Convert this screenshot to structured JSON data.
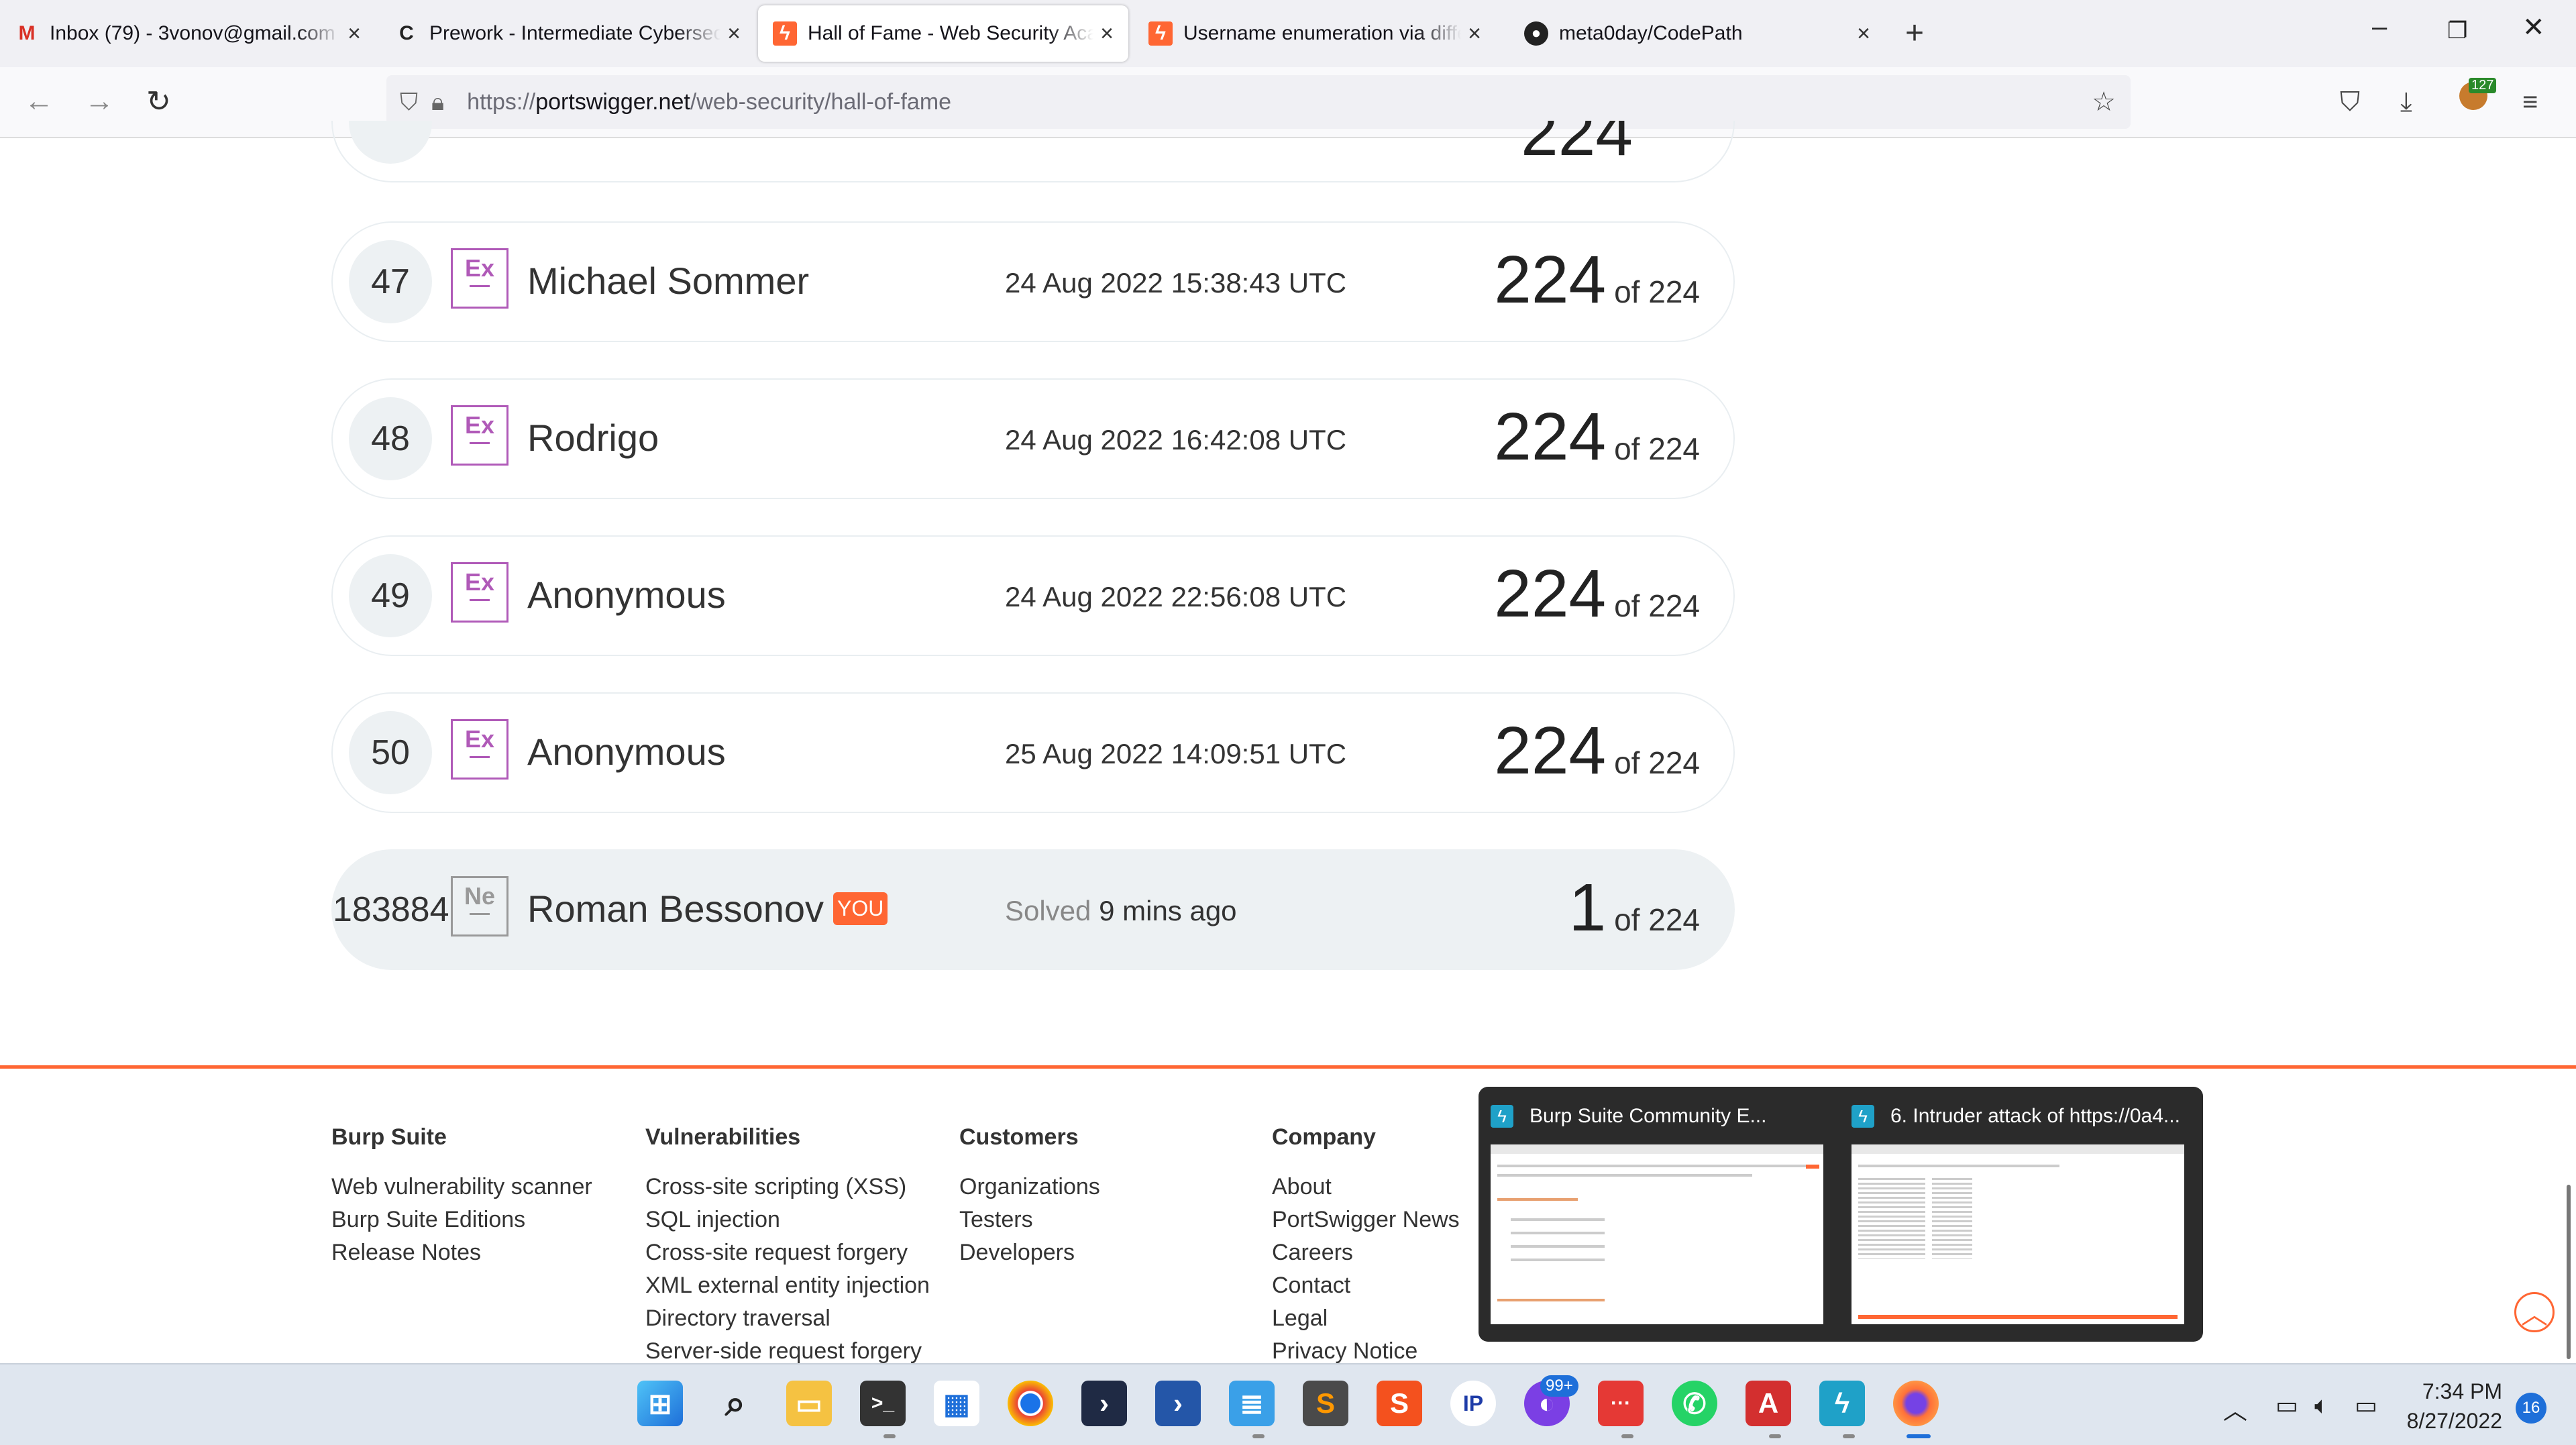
{
  "browser": {
    "tabs": [
      {
        "title": "Inbox (79) - 3vonov@gmail.com",
        "favicon": "gmail-icon",
        "active": false
      },
      {
        "title": "Prework - Intermediate Cybersecurity",
        "favicon": "codepath-icon",
        "active": false
      },
      {
        "title": "Hall of Fame - Web Security Academy",
        "favicon": "portswigger-icon",
        "active": true
      },
      {
        "title": "Username enumeration via different responses",
        "favicon": "portswigger-icon",
        "active": false
      },
      {
        "title": "meta0day/CodePath",
        "favicon": "github-icon",
        "active": false
      }
    ],
    "url": {
      "scheme": "https://",
      "host": "portswigger.net",
      "path": "/web-security/hall-of-fame"
    },
    "extension_badge": "127"
  },
  "leaderboard": {
    "rows": [
      {
        "rank": "47",
        "badge": "Ex",
        "name": "Michael Sommer",
        "date": "24 Aug 2022 15:38:43 UTC",
        "score": "224",
        "total": "of 224"
      },
      {
        "rank": "48",
        "badge": "Ex",
        "name": "Rodrigo",
        "date": "24 Aug 2022 16:42:08 UTC",
        "score": "224",
        "total": "of 224"
      },
      {
        "rank": "49",
        "badge": "Ex",
        "name": "Anonymous",
        "date": "24 Aug 2022 22:56:08 UTC",
        "score": "224",
        "total": "of 224"
      },
      {
        "rank": "50",
        "badge": "Ex",
        "name": "Anonymous",
        "date": "25 Aug 2022 14:09:51 UTC",
        "score": "224",
        "total": "of 224"
      }
    ],
    "current_user": {
      "rank": "183884",
      "badge": "Ne",
      "name": "Roman Bessonov",
      "you_label": "YOU",
      "solved_label": "Solved",
      "solved_time": "9 mins ago",
      "score": "1",
      "total": "of 224"
    }
  },
  "footer": {
    "columns": [
      {
        "heading": "Burp Suite",
        "links": [
          "Web vulnerability scanner",
          "Burp Suite Editions",
          "Release Notes"
        ]
      },
      {
        "heading": "Vulnerabilities",
        "links": [
          "Cross-site scripting (XSS)",
          "SQL injection",
          "Cross-site request forgery",
          "XML external entity injection",
          "Directory traversal",
          "Server-side request forgery"
        ]
      },
      {
        "heading": "Customers",
        "links": [
          "Organizations",
          "Testers",
          "Developers"
        ]
      },
      {
        "heading": "Company",
        "links": [
          "About",
          "PortSwigger News",
          "Careers",
          "Contact",
          "Legal",
          "Privacy Notice"
        ]
      }
    ]
  },
  "thumbnail_popup": {
    "items": [
      {
        "title": "Burp Suite Community E..."
      },
      {
        "title": "6. Intruder attack of https://0a4..."
      }
    ]
  },
  "taskbar": {
    "time": "7:34 PM",
    "date": "8/27/2022",
    "notification_count": "16",
    "badge_count": "99+"
  },
  "colors": {
    "accent": "#ff6633",
    "expert_badge": "#b05ab8"
  }
}
